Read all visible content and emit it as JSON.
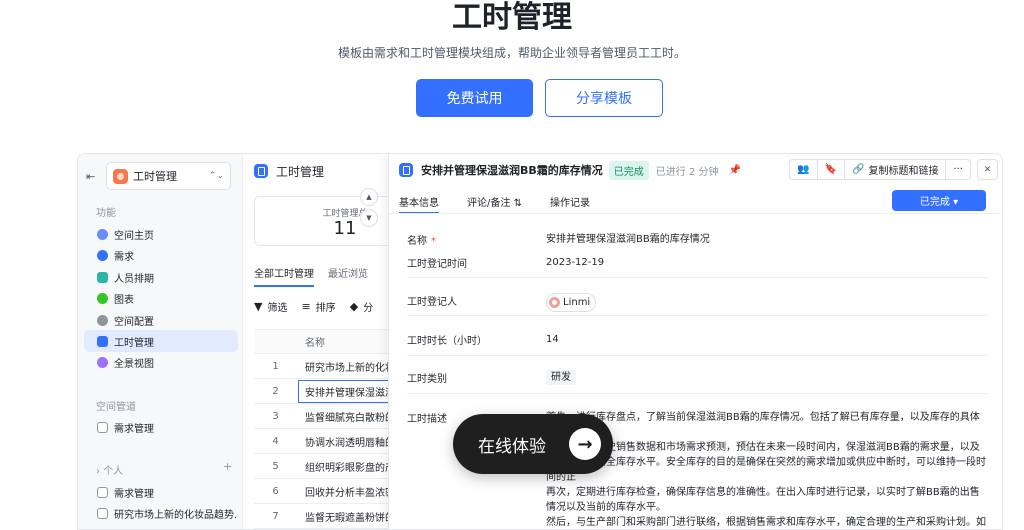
{
  "hero": {
    "title": "工时管理",
    "subtitle": "模板由需求和工时管理模块组成，帮助企业领导者管理员工工时。",
    "primary_button": "免费试用",
    "secondary_button": "分享模板"
  },
  "sidebar": {
    "space_name": "工时管理",
    "section_function": "功能",
    "items": [
      {
        "label": "空间主页",
        "color": "#6b8cff"
      },
      {
        "label": "需求",
        "color": "#3370ff"
      },
      {
        "label": "人员排期",
        "color": "#2bb5a8"
      },
      {
        "label": "图表",
        "color": "#34c724"
      },
      {
        "label": "空间配置",
        "color": "#8f959e"
      },
      {
        "label": "工时管理",
        "color": "#3370ff"
      },
      {
        "label": "全景视图",
        "color": "#9f6fff"
      }
    ],
    "section_space_manage": "空间管道",
    "space_manage_items": [
      {
        "label": "需求管理"
      }
    ],
    "section_personal": "个人",
    "personal_items": [
      {
        "label": "需求管理"
      },
      {
        "label": "研究市场上新的化妆品趋势..."
      }
    ]
  },
  "list_panel": {
    "title": "工时管理",
    "stat_label": "工时管理总",
    "stat_value": "11",
    "tabs": [
      "全部工时管理",
      "最近浏览"
    ],
    "toolbar": [
      "筛选",
      "排序",
      "分"
    ],
    "table_header": "名称",
    "rows": [
      {
        "n": "1",
        "name": "研究市场上新的化妆品趋势"
      },
      {
        "n": "2",
        "name": "安排并管理保湿滋润BB霜的库存情况"
      },
      {
        "n": "3",
        "name": "监督细腻亮白散粉的生产"
      },
      {
        "n": "4",
        "name": "协调水润透明唇釉的供应"
      },
      {
        "n": "5",
        "name": "组织明彩眼影盘的产品测试"
      },
      {
        "n": "6",
        "name": "回收并分析丰盈浓密睫毛膏"
      },
      {
        "n": "7",
        "name": "监督无暇遮盖粉饼的质量"
      }
    ]
  },
  "detail": {
    "title": "安排并管理保湿滋润BB霜的库存情况",
    "status_badge": "已完成",
    "elapsed": "已进行 2 分钟",
    "copy_button": "复制标题和链接",
    "tabs": [
      "基本信息",
      "评论/备注",
      "操作记录"
    ],
    "status_button": "已完成 ▾",
    "fields": {
      "name_label": "名称",
      "name_value": "安排并管理保湿滋润BB霜的库存情况",
      "date_label": "工时登记时间",
      "date_value": "2023-12-19",
      "person_label": "工时登记人",
      "person_value": "Linmi",
      "hours_label": "工时时长（小时）",
      "hours_value": "14",
      "type_label": "工时类别",
      "type_value": "研发",
      "desc_label": "工时描述"
    },
    "description": [
      "首先，进行库存盘点，了解当前保湿滋润BB霜的库存情况。包括了解已有库存量，以及库存的具体位置",
      "其次，根据历史销售数据和市场需求预测，预估在未来一段时间内，保湿滋润BB霜的需求量，以及需要设定的安全库存水平。安全库存的目的是确保在突然的需求增加或供应中断时，可以维持一段时间的正",
      "再次，定期进行库存检查，确保库存信息的准确性。在出入库时进行记录，以实时了解BB霜的出售情况以及当前的库存水平。",
      "然后，与生产部门和采购部门进行联络，根据销售需求和库存水平，确定合理的生产和采购计划。如果预计需求量会增加，可以提前通知生产部门，确保库存能够满足需求。"
    ]
  },
  "cta": {
    "label": "在线体验"
  }
}
